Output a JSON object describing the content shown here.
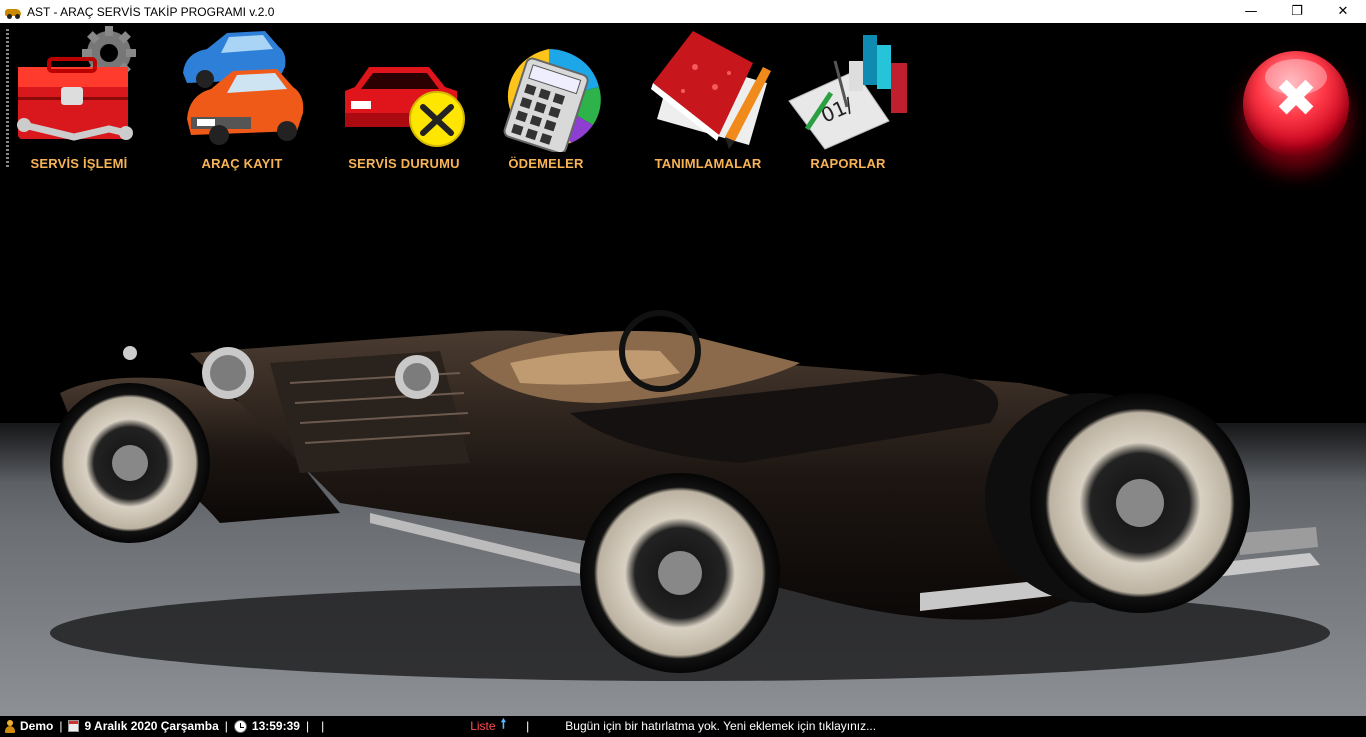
{
  "window": {
    "title": "AST - ARAÇ SERVİS TAKİP PROGRAMI v.2.0",
    "controls": {
      "minimize": "—",
      "restore": "❐",
      "close": "✕"
    }
  },
  "toolbar": {
    "items": [
      {
        "id": "servis-islemi",
        "label": "SERVİS İŞLEMİ",
        "icon": "toolbox-gear-icon"
      },
      {
        "id": "arac-kayit",
        "label": "ARAÇ KAYIT",
        "icon": "cars-icon"
      },
      {
        "id": "servis-durumu",
        "label": "SERVİS DURUMU",
        "icon": "car-tools-icon"
      },
      {
        "id": "odemeler",
        "label": "ÖDEMELER",
        "icon": "calculator-pie-icon"
      },
      {
        "id": "tanimlamalar",
        "label": "TANIMLAMALAR",
        "icon": "notebook-pen-icon"
      },
      {
        "id": "raporlar",
        "label": "RAPORLAR",
        "icon": "report-chart-icon"
      }
    ],
    "exit_icon": "exit-x-icon",
    "exit_glyph": "✖"
  },
  "statusbar": {
    "user": "Demo",
    "date": "9 Aralık 2020 Çarşamba",
    "time": "13:59:39",
    "list_label": "Liste",
    "list_arrow": "🠕",
    "reminder": "Bugün için bir hatırlatma yok. Yeni eklemek için tıklayınız...",
    "separator": "|"
  },
  "colors": {
    "toolbar_label": "#f7b356",
    "background": "#000000",
    "list_label": "#ff5050"
  }
}
